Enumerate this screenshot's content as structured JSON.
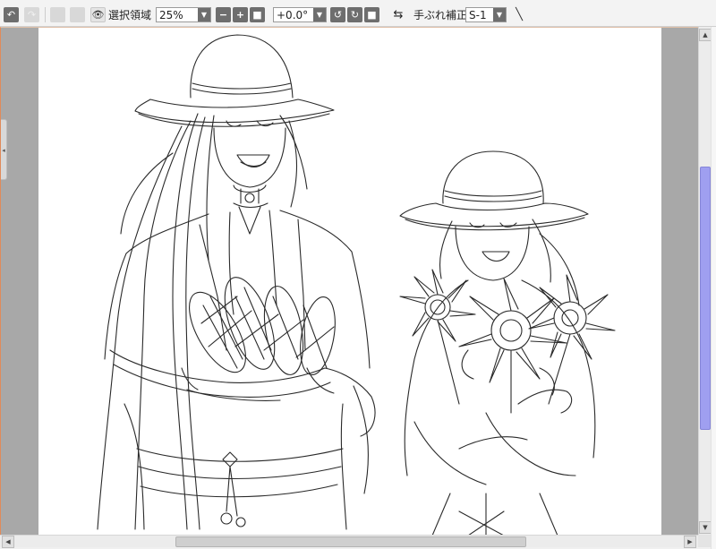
{
  "toolbar": {
    "undo_icon": "undo-icon",
    "redo_icon": "redo-icon",
    "selection_area_label": "選択領域",
    "zoom_value": "25%",
    "zoom_out_glyph": "−",
    "zoom_in_glyph": "+",
    "rotation_value": "+0.0°",
    "stabilizer_label": "手ぶれ補正",
    "stabilizer_value": "S-1"
  },
  "colors": {
    "accent_scroll_thumb": "#9f9ff0",
    "canvas_bg": "#a8a8a8",
    "paper": "#ffffff",
    "focus_border": "#e08a5a"
  },
  "canvas": {
    "artwork_description_icon": "line-art-drawing",
    "line_color": "#2a2a2a"
  },
  "scrollbars": {
    "vertical_position_fraction": 0.28,
    "horizontal_position_fraction": 0.25
  }
}
